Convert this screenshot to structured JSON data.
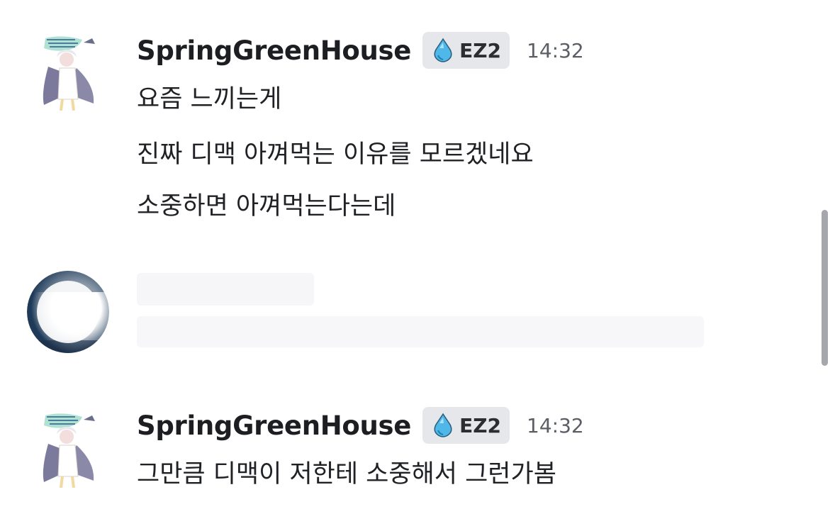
{
  "messages": [
    {
      "username": "SpringGreenHouse",
      "role": "EZ2",
      "time": "14:32",
      "lines": [
        "요즘 느끼는게",
        "진짜 디맥 아껴먹는 이유를 모르겠네요",
        "소중하면 아껴먹는다는데"
      ]
    },
    {
      "username": "SpringGreenHouse",
      "role": "EZ2",
      "time": "14:32",
      "lines": [
        "그만큼 디맥이 저한테 소중해서 그런가봄"
      ]
    }
  ],
  "colors": {
    "badge_bg": "#e6e7eb",
    "gem": "#4fb8e8",
    "username": "#1d1e22",
    "timestamp": "#5c5e66"
  },
  "icons": {
    "role_gem": "water-drop-gem-icon"
  }
}
